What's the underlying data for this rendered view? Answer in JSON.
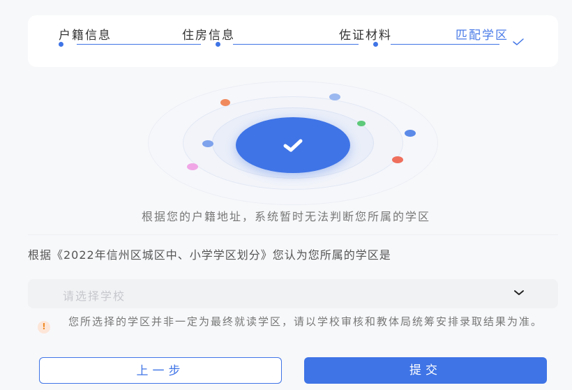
{
  "steps": [
    {
      "label": "户籍信息",
      "status": "done"
    },
    {
      "label": "住房信息",
      "status": "done"
    },
    {
      "label": "佐证材料",
      "status": "done"
    },
    {
      "label": "匹配学区",
      "status": "active"
    }
  ],
  "success_icon": "check-icon",
  "result_message": "根据您的户籍地址，系统暂时无法判断您所属的学区",
  "question": "根据《2022年信州区城区中、小学学区划分》您认为您所属的学区是",
  "school_select": {
    "placeholder": "请选择学校",
    "icon": "chevron-down-icon"
  },
  "notice": {
    "icon": "warning-icon",
    "text": "您所选择的学区并非一定为最终就读学区，请以学校审核和教体局统筹安排录取结果为准。"
  },
  "buttons": {
    "prev": "上一步",
    "submit": "提交"
  },
  "colors": {
    "primary": "#3f74e6",
    "background": "#f7f8fa",
    "warning": "#f08a24"
  }
}
